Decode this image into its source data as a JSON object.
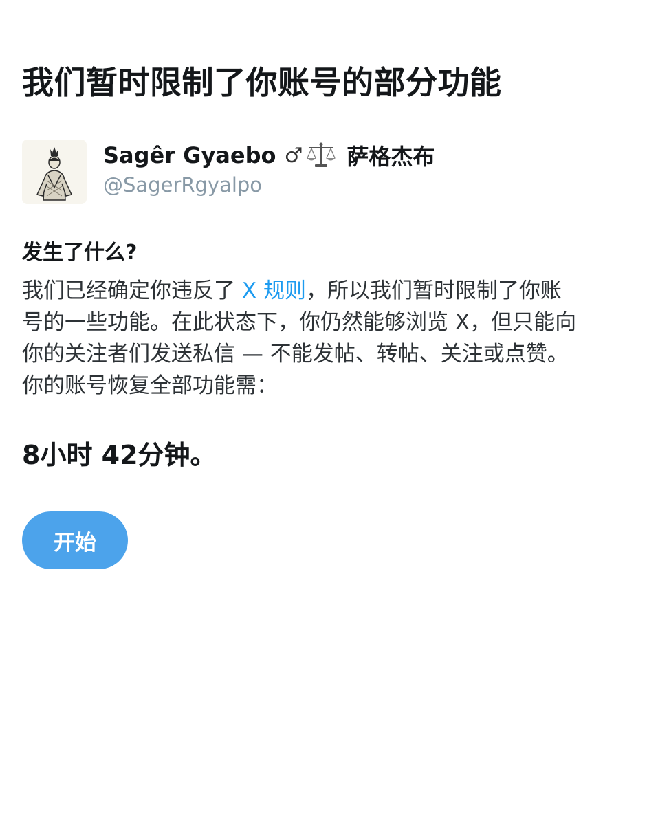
{
  "page": {
    "title": "我们暂时限制了你账号的部分功能"
  },
  "account": {
    "display_name": "Sagêr Gyaebo",
    "male_symbol": "♂",
    "scales_icon": "balance-scale-icon",
    "display_name_cn": "萨格杰布",
    "username": "@SagerRgyalpo"
  },
  "notice": {
    "heading": "发生了什么?",
    "line1_before_link": "我们已经确定你违反了 ",
    "rules_link": "X 规则",
    "line1_after_link": "，所以我们暂时限制了你账",
    "line2": "号的一些功能。在此状态下，你仍然能够浏览 X，但只能向",
    "line3": "你的关注者们发送私信 — 不能发帖、转帖、关注或点赞。",
    "line4": "你的账号恢复全部功能需："
  },
  "timer": {
    "remaining": "8小时 42分钟。"
  },
  "actions": {
    "start_label": "开始"
  },
  "colors": {
    "link": "#1d9bf0",
    "button": "#4ca3eb",
    "secondary_text": "#8899a6"
  }
}
